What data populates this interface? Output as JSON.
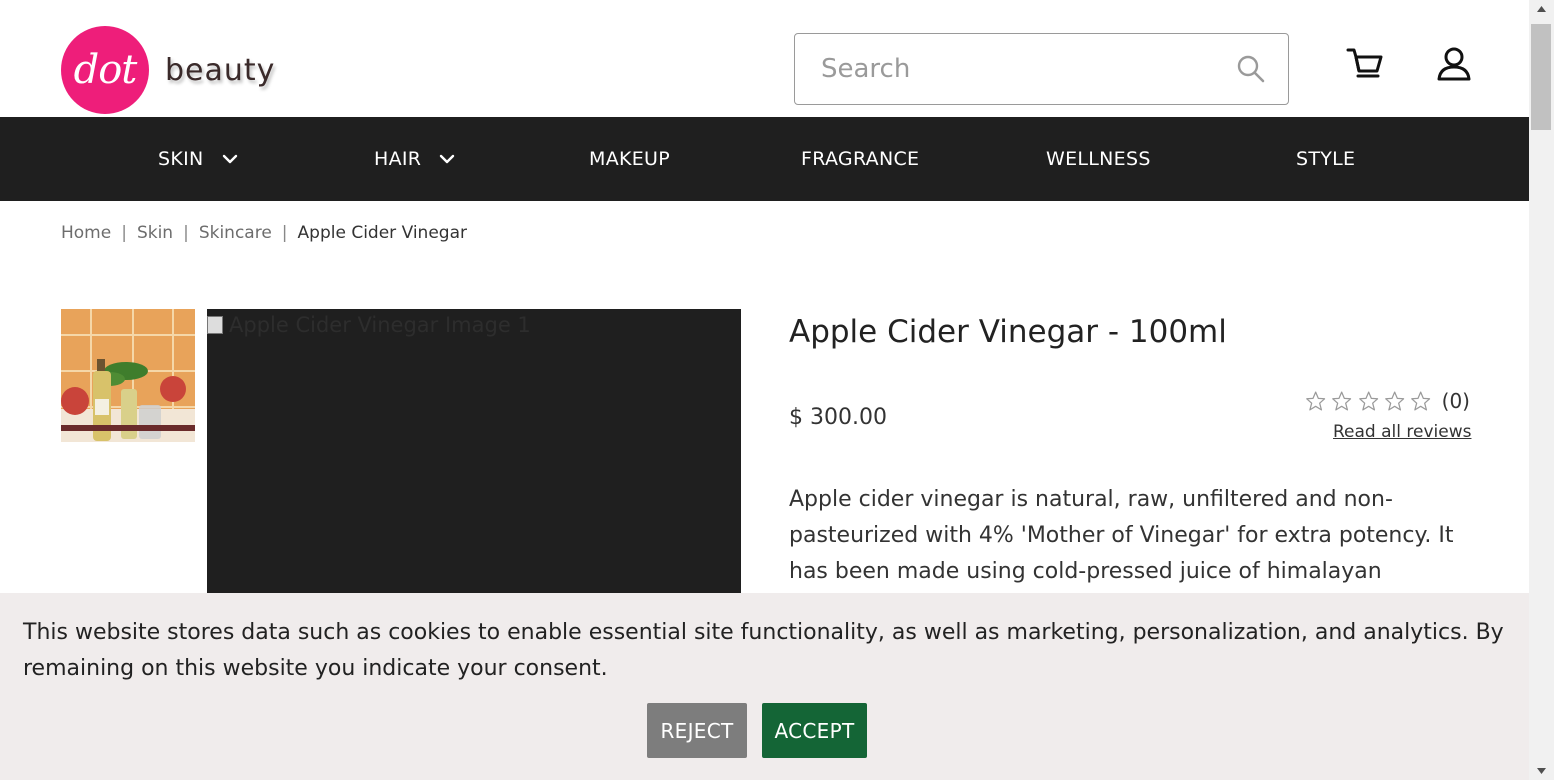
{
  "brand": {
    "logo_mark": "dot",
    "logo_text": "beauty"
  },
  "search": {
    "placeholder": "Search",
    "value": ""
  },
  "icons": {
    "search": "search-icon",
    "cart": "cart-icon",
    "account": "user-icon"
  },
  "nav": {
    "items": [
      {
        "label": "SKIN",
        "has_dropdown": true
      },
      {
        "label": "HAIR",
        "has_dropdown": true
      },
      {
        "label": "MAKEUP",
        "has_dropdown": false
      },
      {
        "label": "FRAGRANCE",
        "has_dropdown": false
      },
      {
        "label": "WELLNESS",
        "has_dropdown": false
      },
      {
        "label": "STYLE",
        "has_dropdown": false
      }
    ]
  },
  "breadcrumb": {
    "items": [
      "Home",
      "Skin",
      "Skincare"
    ],
    "current": "Apple Cider Vinegar",
    "separator": "|"
  },
  "product": {
    "main_image_alt": "Apple Cider Vinegar Image 1",
    "title": "Apple Cider Vinegar - 100ml",
    "price": "$ 300.00",
    "rating": {
      "stars_filled": 0,
      "stars_total": 5,
      "count": "(0)",
      "read_reviews": "Read all reviews"
    },
    "description": "Apple cider vinegar is natural, raw, unfiltered and non-pasteurized with 4% 'Mother of Vinegar' for extra potency. It has been made using cold-pressed juice of himalayan"
  },
  "cookie_banner": {
    "text": "This website stores data such as cookies to enable essential site functionality, as well as marketing, personalization, and analytics. By remaining on this website you indicate your consent.",
    "reject_label": "REJECT",
    "accept_label": "ACCEPT"
  },
  "colors": {
    "brand_pink": "#ee1e7a",
    "nav_background": "#1f1f1f",
    "accept_green": "#146536",
    "reject_gray": "#7d7d7d",
    "banner_background": "#f0ecec"
  }
}
